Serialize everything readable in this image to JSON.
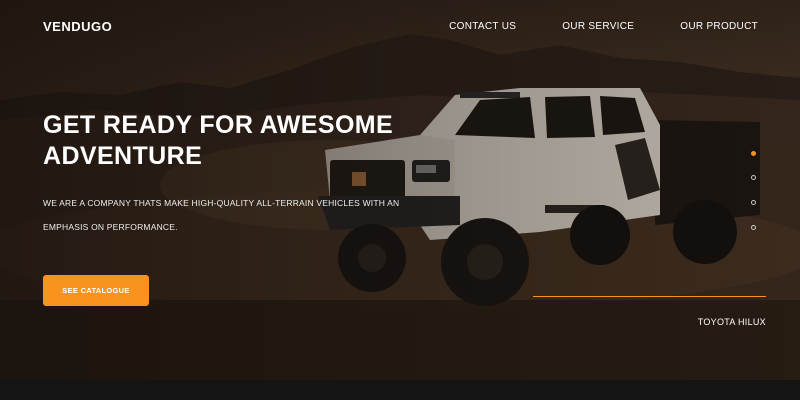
{
  "brand": {
    "logo": "VENDUGO"
  },
  "nav": {
    "items": [
      {
        "label": "CONTACT US"
      },
      {
        "label": "OUR SERVICE"
      },
      {
        "label": "OUR PRODUCT"
      }
    ]
  },
  "hero": {
    "headline": "GET READY FOR AWESOME ADVENTURE",
    "subtext": "WE ARE A COMPANY THATS MAKE HIGH-QUALITY ALL-TERRAIN VEHICLES WITH AN EMPHASIS ON PERFORMANCE.",
    "cta_label": "SEE CATALOGUE",
    "caption": "TOYOTA HILUX"
  },
  "slider": {
    "total": 4,
    "active_index": 0
  },
  "colors": {
    "accent": "#f7931e",
    "background": "#1e1610"
  },
  "icons": [
    "truck-image",
    "mountain-silhouette"
  ]
}
